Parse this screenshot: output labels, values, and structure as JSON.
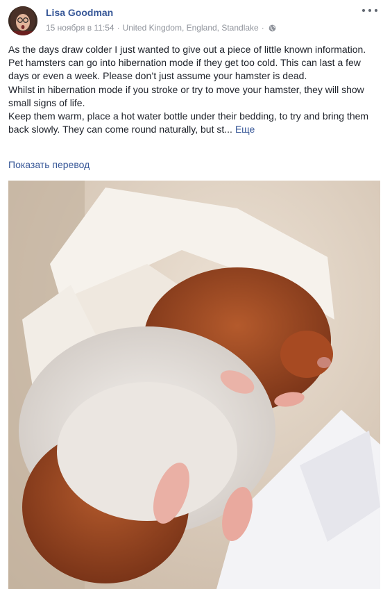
{
  "post": {
    "author": "Lisa Goodman",
    "date": "15 ноября в 11:54",
    "location": "United Kingdom, England, Standlake",
    "text": [
      "As the days draw colder I just wanted to give out a piece of little known information.",
      "Pet hamsters can go into hibernation mode if they get too cold. This can last a few days or even a week. Please don’t just assume your hamster is dead.",
      "Whilst in hibernation mode if you stroke or try to move your hamster, they will show small signs of life.",
      "Keep them warm, place a hot water bottle under their bedding, to try and bring them back slowly. They can come round naturally, but st..."
    ],
    "see_more": "Еще",
    "translate": "Показать перевод"
  },
  "icons": {
    "more": "more-horizontal-icon",
    "privacy": "globe-icon"
  }
}
